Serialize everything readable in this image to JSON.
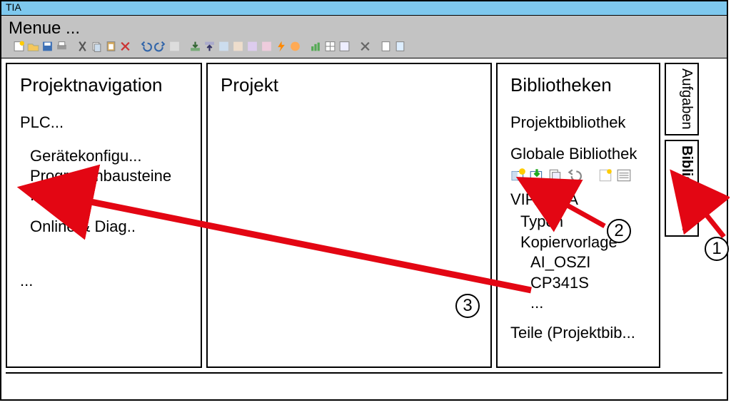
{
  "window": {
    "title": "TIA"
  },
  "menu": {
    "label": "Menue ..."
  },
  "panels": {
    "nav": {
      "title": "Projektnavigation",
      "plc": "PLC...",
      "device": "Gerätekonfigu...",
      "blocks": "Programmbausteine",
      "blocks_more": "...",
      "online": "Online & Diag..",
      "more": "..."
    },
    "project": {
      "title": "Projekt"
    },
    "lib": {
      "title": "Bibliotheken",
      "projbib": "Projektbibliothek",
      "global": "Globale Bibliothek",
      "vipa": "VIPA_TIA",
      "typen": "Typen",
      "kopier": "Kopiervorlage",
      "ai": "AI_OSZI",
      "cp": "CP341S",
      "more": "...",
      "teile": "Teile (Projektbib..."
    }
  },
  "sidetabs": {
    "aufgaben": "Aufgaben",
    "bib": "Bibliotheken"
  },
  "annotations": {
    "n1": "1",
    "n2": "2",
    "n3": "3"
  },
  "lib_icons": [
    "open-library-icon",
    "import-library-icon",
    "copy-icon",
    "undo-icon",
    "new-icon",
    "details-icon"
  ]
}
